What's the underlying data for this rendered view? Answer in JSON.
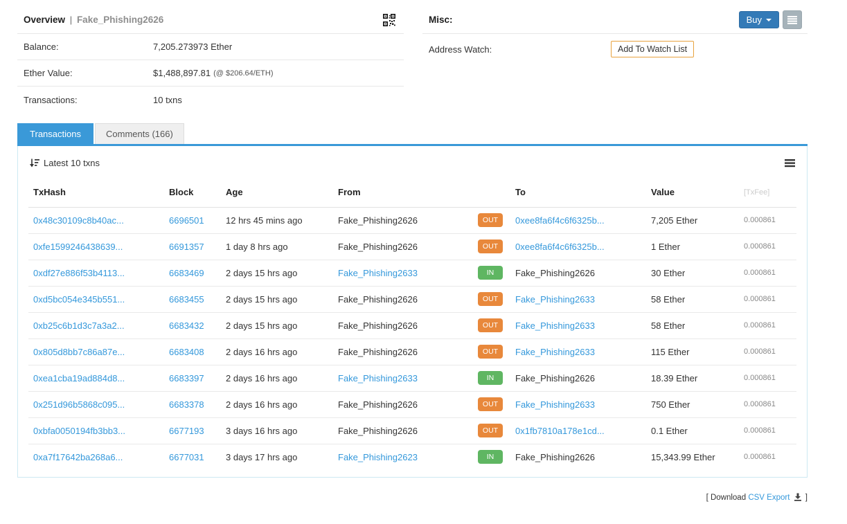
{
  "overview": {
    "title": "Overview",
    "separator": "|",
    "subtitle": "Fake_Phishing2626",
    "rows": [
      {
        "label": "Balance:",
        "value": "7,205.273973 Ether",
        "note": ""
      },
      {
        "label": "Ether Value:",
        "value": "$1,488,897.81",
        "note": "(@ $206.64/ETH)"
      },
      {
        "label": "Transactions:",
        "value": "10 txns",
        "note": ""
      }
    ]
  },
  "misc": {
    "title": "Misc:",
    "buy_label": "Buy",
    "address_watch_label": "Address Watch:",
    "add_watch_button": "Add To Watch List"
  },
  "tabs": {
    "transactions": "Transactions",
    "comments": "Comments (166)"
  },
  "transactions": {
    "toolbar_label": "Latest 10 txns",
    "columns": [
      "TxHash",
      "Block",
      "Age",
      "From",
      "",
      "To",
      "Value",
      "[TxFee]"
    ],
    "rows": [
      {
        "txhash": "0x48c30109c8b40ac...",
        "block": "6696501",
        "age": "12 hrs 45 mins ago",
        "from": {
          "text": "Fake_Phishing2626",
          "link": false
        },
        "dir": "OUT",
        "to": {
          "text": "0xee8fa6f4c6f6325b...",
          "link": true
        },
        "value": "7,205 Ether",
        "fee": "0.000861"
      },
      {
        "txhash": "0xfe1599246438639...",
        "block": "6691357",
        "age": "1 day 8 hrs ago",
        "from": {
          "text": "Fake_Phishing2626",
          "link": false
        },
        "dir": "OUT",
        "to": {
          "text": "0xee8fa6f4c6f6325b...",
          "link": true
        },
        "value": "1 Ether",
        "fee": "0.000861"
      },
      {
        "txhash": "0xdf27e886f53b4113...",
        "block": "6683469",
        "age": "2 days 15 hrs ago",
        "from": {
          "text": "Fake_Phishing2633",
          "link": true
        },
        "dir": "IN",
        "to": {
          "text": "Fake_Phishing2626",
          "link": false
        },
        "value": "30 Ether",
        "fee": "0.000861"
      },
      {
        "txhash": "0xd5bc054e345b551...",
        "block": "6683455",
        "age": "2 days 15 hrs ago",
        "from": {
          "text": "Fake_Phishing2626",
          "link": false
        },
        "dir": "OUT",
        "to": {
          "text": "Fake_Phishing2633",
          "link": true
        },
        "value": "58 Ether",
        "fee": "0.000861"
      },
      {
        "txhash": "0xb25c6b1d3c7a3a2...",
        "block": "6683432",
        "age": "2 days 15 hrs ago",
        "from": {
          "text": "Fake_Phishing2626",
          "link": false
        },
        "dir": "OUT",
        "to": {
          "text": "Fake_Phishing2633",
          "link": true
        },
        "value": "58 Ether",
        "fee": "0.000861"
      },
      {
        "txhash": "0x805d8bb7c86a87e...",
        "block": "6683408",
        "age": "2 days 16 hrs ago",
        "from": {
          "text": "Fake_Phishing2626",
          "link": false
        },
        "dir": "OUT",
        "to": {
          "text": "Fake_Phishing2633",
          "link": true
        },
        "value": "115 Ether",
        "fee": "0.000861"
      },
      {
        "txhash": "0xea1cba19ad884d8...",
        "block": "6683397",
        "age": "2 days 16 hrs ago",
        "from": {
          "text": "Fake_Phishing2633",
          "link": true
        },
        "dir": "IN",
        "to": {
          "text": "Fake_Phishing2626",
          "link": false
        },
        "value": "18.39 Ether",
        "fee": "0.000861"
      },
      {
        "txhash": "0x251d96b5868c095...",
        "block": "6683378",
        "age": "2 days 16 hrs ago",
        "from": {
          "text": "Fake_Phishing2626",
          "link": false
        },
        "dir": "OUT",
        "to": {
          "text": "Fake_Phishing2633",
          "link": true
        },
        "value": "750 Ether",
        "fee": "0.000861"
      },
      {
        "txhash": "0xbfa0050194fb3bb3...",
        "block": "6677193",
        "age": "3 days 16 hrs ago",
        "from": {
          "text": "Fake_Phishing2626",
          "link": false
        },
        "dir": "OUT",
        "to": {
          "text": "0x1fb7810a178e1cd...",
          "link": true
        },
        "value": "0.1 Ether",
        "fee": "0.000861"
      },
      {
        "txhash": "0xa7f17642ba268a6...",
        "block": "6677031",
        "age": "3 days 17 hrs ago",
        "from": {
          "text": "Fake_Phishing2623",
          "link": true
        },
        "dir": "IN",
        "to": {
          "text": "Fake_Phishing2626",
          "link": false
        },
        "value": "15,343.99 Ether",
        "fee": "0.000861"
      }
    ]
  },
  "footer": {
    "prefix": "[ Download",
    "link": "CSV Export",
    "suffix": "]"
  },
  "colors": {
    "link": "#3498db",
    "tab_active": "#3a99d8",
    "out_badge": "#e8883b",
    "in_badge": "#5fb662",
    "buy_button": "#337ab7",
    "watch_button_border": "#e8a23d"
  },
  "icons": {
    "qr": "qr-code-icon",
    "sort": "sort-amount-desc-icon",
    "menu": "hamburger-menu-icon",
    "download": "download-icon",
    "caret": "caret-down-icon"
  }
}
